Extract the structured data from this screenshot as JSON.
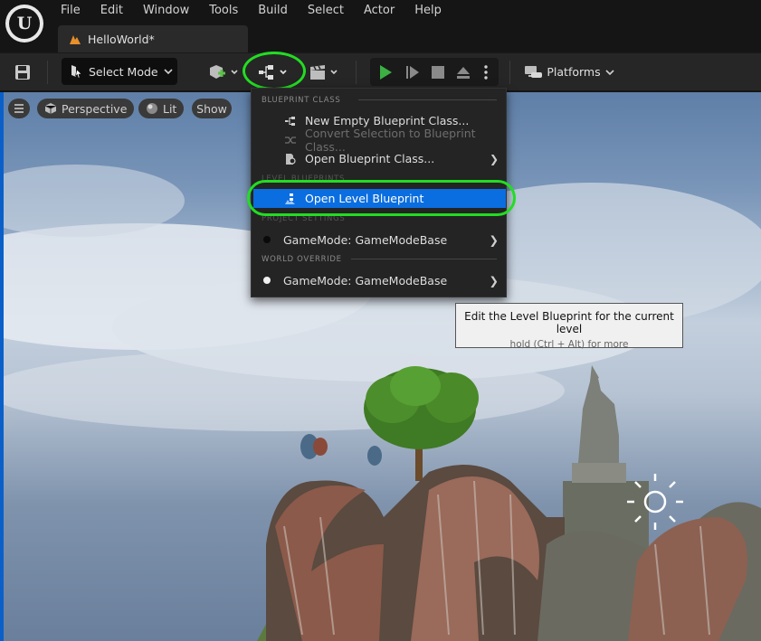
{
  "menubar": {
    "logo": "unreal-engine-logo",
    "items": [
      "File",
      "Edit",
      "Window",
      "Tools",
      "Build",
      "Select",
      "Actor",
      "Help"
    ]
  },
  "doc_tab": {
    "label": "HelloWorld*"
  },
  "toolbar": {
    "select_mode_label": "Select Mode",
    "platforms_label": "Platforms"
  },
  "viewport": {
    "perspective_label": "Perspective",
    "lit_label": "Lit",
    "show_label": "Show"
  },
  "blueprint_menu": {
    "section_blueprint_class": "BLUEPRINT CLASS",
    "new_empty": "New Empty Blueprint Class...",
    "convert_selection": "Convert Selection to Blueprint Class...",
    "open_blueprint_class": "Open Blueprint Class...",
    "section_level_blueprints": "LEVEL BLUEPRINTS",
    "open_level_blueprint": "Open Level Blueprint",
    "section_project_settings": "PROJECT SETTINGS",
    "project_gamemode": "GameMode: GameModeBase",
    "section_world_override": "WORLD OVERRIDE",
    "world_gamemode": "GameMode: GameModeBase"
  },
  "tooltip": {
    "main": "Edit the Level Blueprint for the current level",
    "sub": "hold (Ctrl + Alt) for more"
  },
  "colors": {
    "highlight_ring": "#22dd22",
    "menu_active": "#0a6ee0",
    "play_green": "#3cb043"
  }
}
